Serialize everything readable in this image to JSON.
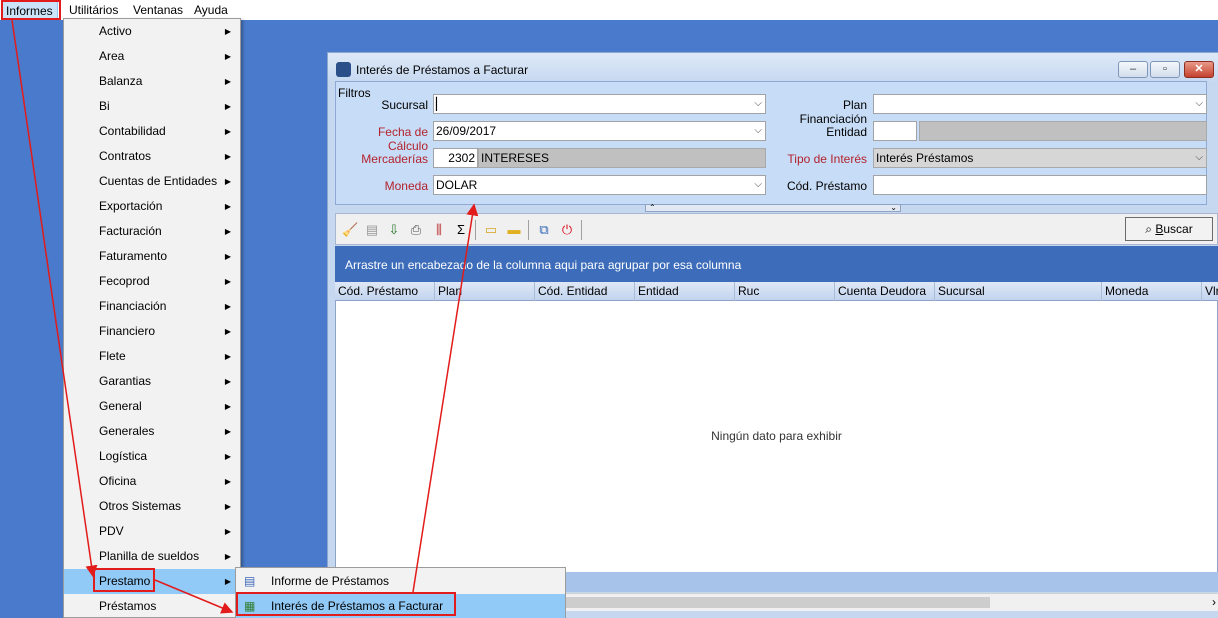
{
  "menubar": {
    "items": [
      "Informes",
      "Utilitários",
      "Ventanas",
      "Ayuda"
    ]
  },
  "window": {
    "title": "Interés de Préstamos a Facturar",
    "filters": {
      "group_label": "Filtros",
      "sucursal": {
        "label": "Sucursal",
        "value": ""
      },
      "fecha_calculo": {
        "label": "Fecha de Cálculo",
        "value": "26/09/2017"
      },
      "mercaderias": {
        "label": "Mercaderías",
        "code": "2302",
        "name": "INTERESES"
      },
      "moneda": {
        "label": "Moneda",
        "value": "DOLAR"
      },
      "plan_financiacion": {
        "label": "Plan Financiación",
        "value": ""
      },
      "entidad": {
        "label": "Entidad",
        "code": "",
        "name": ""
      },
      "tipo_interes": {
        "label": "Tipo de Interés",
        "value": "Interés Préstamos"
      },
      "cod_prestamo": {
        "label": "Cód. Préstamo",
        "value": ""
      }
    },
    "toolbar": {
      "icons": [
        "broom-icon",
        "copy-icon",
        "export-icon",
        "print-icon",
        "columns-icon",
        "sigma-icon",
        "open-folder-icon",
        "folder-icon",
        "layers-icon",
        "power-icon"
      ],
      "buscar_prefix": "",
      "buscar_underlined": "B",
      "buscar_rest": "uscar"
    },
    "grid": {
      "group_hint": "Arrastre un encabezado de la columna aqui para agrupar por esa columna",
      "columns": [
        "Cód. Préstamo",
        "Plan",
        "Cód. Entidad",
        "Entidad",
        "Ruc",
        "Cuenta Deudora",
        "Sucursal",
        "Moneda",
        "Vlr"
      ],
      "empty_text": "Ningún dato para exhibir"
    }
  },
  "menu": {
    "items": [
      "Activo",
      "Area",
      "Balanza",
      "Bi",
      "Contabilidad",
      "Contratos",
      "Cuentas de Entidades",
      "Exportación",
      "Facturación",
      "Faturamento",
      "Fecoprod",
      "Financiación",
      "Financiero",
      "Flete",
      "Garantias",
      "General",
      "Generales",
      "Logística",
      "Oficina",
      "Otros Sistemas",
      "PDV",
      "Planilla de sueldos",
      "Prestamo",
      "Préstamos"
    ],
    "highlighted_index": 22
  },
  "submenu": {
    "items": [
      "Informe de Préstamos",
      "Interés de Préstamos a Facturar"
    ],
    "highlighted_index": 1
  },
  "colors": {
    "annotation_red": "#e21b1b",
    "menu_highlight": "#91c9f7",
    "desktop": "#4a7acb"
  }
}
